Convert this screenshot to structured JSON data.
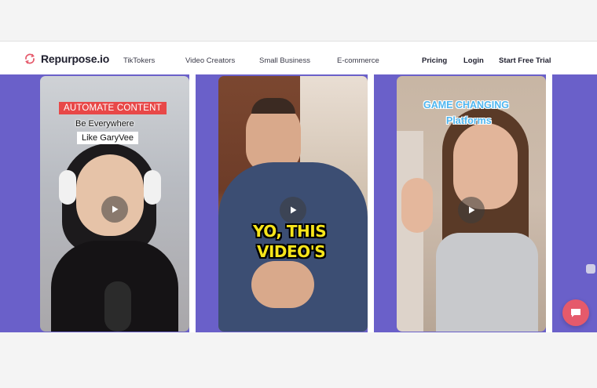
{
  "brand": {
    "name": "Repurpose.io",
    "accent": "#e55a6b",
    "stage_color": "#6a60c9"
  },
  "nav": {
    "links": [
      "TikTokers",
      "Video Creators",
      "Small Business",
      "E-commerce"
    ],
    "pricing": "Pricing",
    "login": "Login",
    "cta": "Start Free Trial"
  },
  "cards": [
    {
      "caption_red": "AUTOMATE CONTENT",
      "caption_line2": "Be Everywhere",
      "caption_line3": "Like GaryVee"
    },
    {
      "caption_line1": "YO, THIS",
      "caption_line2": "VIDEO'S"
    },
    {
      "caption_line1": "GAME CHANGING",
      "caption_line2": "Platforms"
    }
  ],
  "icons": {
    "logo": "repurpose-logo-icon",
    "play": "play-icon",
    "chat": "chat-icon"
  }
}
